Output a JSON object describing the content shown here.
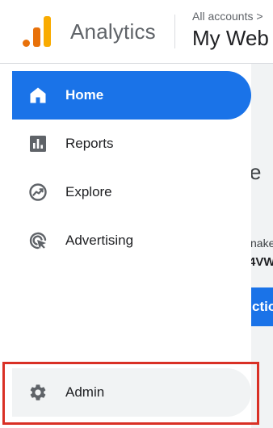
{
  "header": {
    "app_name": "Analytics",
    "accounts_breadcrumb": "All accounts >",
    "property_name": "My Web"
  },
  "sidebar": {
    "items": [
      {
        "label": "Home",
        "icon": "home-icon",
        "active": true
      },
      {
        "label": "Reports",
        "icon": "bar-chart-icon",
        "active": false
      },
      {
        "label": "Explore",
        "icon": "explore-icon",
        "active": false
      },
      {
        "label": "Advertising",
        "icon": "advertising-icon",
        "active": false
      }
    ],
    "admin": {
      "label": "Admin",
      "icon": "gear-icon"
    }
  },
  "main": {
    "heading_fragment": "ve",
    "text_fragment": "nake",
    "bold_fragment": "4VW",
    "button_fragment": "ctio"
  },
  "colors": {
    "accent": "#1a73e8",
    "highlight_border": "#d93025",
    "logo_orange": "#e8710a",
    "logo_yellow": "#f9ab00"
  }
}
